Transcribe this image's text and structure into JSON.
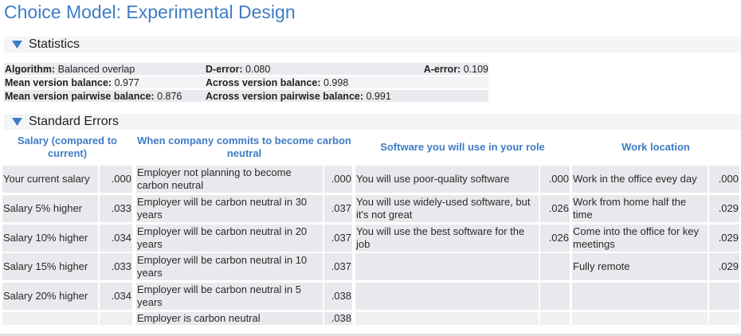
{
  "title": "Choice Model: Experimental Design",
  "statistics": {
    "header": "Statistics",
    "rows": [
      [
        {
          "label": "Algorithm:",
          "value": "Balanced overlap"
        },
        {
          "label": "D-error:",
          "value": "0.080"
        },
        {
          "label": "A-error:",
          "value": "0.109"
        }
      ],
      [
        {
          "label": "Mean version balance:",
          "value": "0.977"
        },
        {
          "label": "Across version balance:",
          "value": "0.998"
        }
      ],
      [
        {
          "label": "Mean version pairwise balance:",
          "value": "0.876"
        },
        {
          "label": "Across version pairwise balance:",
          "value": "0.991"
        }
      ]
    ]
  },
  "standard_errors": {
    "header": "Standard Errors",
    "attributes": [
      {
        "name": "Salary (compared to current)",
        "levels": [
          {
            "label": "Your current salary",
            "se": ".000"
          },
          {
            "label": "Salary 5% higher",
            "se": ".033"
          },
          {
            "label": "Salary 10% higher",
            "se": ".034"
          },
          {
            "label": "Salary 15% higher",
            "se": ".033"
          },
          {
            "label": "Salary 20% higher",
            "se": ".034"
          }
        ]
      },
      {
        "name": "When company commits to become carbon neutral",
        "levels": [
          {
            "label": "Employer not planning to become carbon neutral",
            "se": ".000"
          },
          {
            "label": "Employer will be carbon neutral in 30 years",
            "se": ".037"
          },
          {
            "label": "Employer will be carbon neutral in 20 years",
            "se": ".037"
          },
          {
            "label": "Employer will be carbon neutral in 10 years",
            "se": ".037"
          },
          {
            "label": "Employer will be carbon neutral in 5 years",
            "se": ".038"
          },
          {
            "label": "Employer is carbon neutral",
            "se": ".038"
          }
        ]
      },
      {
        "name": "Software you will use in your role",
        "levels": [
          {
            "label": "You will use poor-quality software",
            "se": ".000"
          },
          {
            "label": "You will use widely-used software, but it's not great",
            "se": ".026"
          },
          {
            "label": "You will use the best software for the job",
            "se": ".026"
          }
        ]
      },
      {
        "name": "Work location",
        "levels": [
          {
            "label": "Work in the office evey day",
            "se": ".000"
          },
          {
            "label": "Work from home half the time",
            "se": ".029"
          },
          {
            "label": "Come into the office for key meetings",
            "se": ".029"
          },
          {
            "label": "Fully remote",
            "se": ".029"
          }
        ]
      }
    ]
  },
  "colors": {
    "accent": "#3e7cc4",
    "cell_bg": "#e8e9ec",
    "header_bg": "#f4f5f7"
  }
}
